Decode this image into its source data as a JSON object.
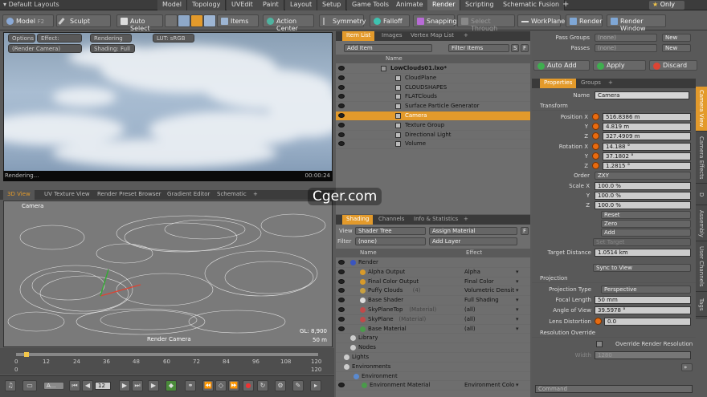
{
  "topbar": {
    "layout": "Default Layouts",
    "tabs": [
      "Model",
      "Topology",
      "UVEdit",
      "Paint",
      "Layout",
      "Setup",
      "Game Tools",
      "Animate",
      "Render",
      "Scripting",
      "Schematic Fusion"
    ],
    "active_tab": "Render",
    "only": "Only"
  },
  "toolbar": {
    "model": "Model",
    "model_key": "F2",
    "sculpt": "Sculpt",
    "auto_select": "Auto Select",
    "items": "Items",
    "action_center": "Action Center",
    "symmetry": "Symmetry",
    "falloff": "Falloff",
    "snapping": "Snapping",
    "select_through": "Select Through",
    "workplane": "WorkPlane",
    "render": "Render",
    "render_window": "Render Window"
  },
  "render_view": {
    "options": "Options",
    "effect": "Effect: Shadin",
    "rendering_dd": "Rendering",
    "lut": "LUT: sRGB",
    "camera": "(Render Camera)",
    "shading": "Shading: Full",
    "status": "Rendering...",
    "time": "00:00:24"
  },
  "view3d": {
    "tabs": [
      "3D View",
      "UV Texture View",
      "Render Preset Browser",
      "Gradient Editor",
      "Schematic"
    ],
    "camera": "Camera",
    "render_camera": "Render Camera",
    "gl": "GL: 8,900",
    "dist": "50 m"
  },
  "timeline": {
    "ticks": [
      "0",
      "12",
      "24",
      "36",
      "48",
      "60",
      "72",
      "84",
      "96",
      "108",
      "120"
    ],
    "start": "0",
    "end": "120"
  },
  "bottombar": {
    "anim": "A...",
    "frame": "12"
  },
  "item_list": {
    "tabs": [
      "Item List",
      "Images",
      "Vertex Map List"
    ],
    "add_item": "Add Item",
    "filter": "Filter Items",
    "s": "S",
    "f": "F",
    "name_col": "Name",
    "items": [
      {
        "name": "LowClouds01.lxo*",
        "indent": 0,
        "bold": true
      },
      {
        "name": "CloudPlane",
        "indent": 1
      },
      {
        "name": "CLOUDSHAPES",
        "indent": 1
      },
      {
        "name": "FLATClouds",
        "indent": 1
      },
      {
        "name": "Surface Particle Generator",
        "indent": 1
      },
      {
        "name": "Camera",
        "indent": 1,
        "selected": true
      },
      {
        "name": "Texture Group",
        "indent": 1
      },
      {
        "name": "Directional Light",
        "indent": 1
      },
      {
        "name": "Volume",
        "indent": 1
      }
    ]
  },
  "shading": {
    "tabs": [
      "Shading",
      "Channels",
      "Info & Statistics"
    ],
    "view_label": "View",
    "view": "Shader Tree",
    "assign": "Assign Material",
    "f": "F",
    "filter_label": "Filter",
    "filter": "(none)",
    "add_layer": "Add Layer",
    "cols": [
      "Name",
      "Effect"
    ],
    "rows": [
      {
        "name": "Render",
        "effect": ""
      },
      {
        "name": "Alpha Output",
        "effect": "Alpha"
      },
      {
        "name": "Final Color Output",
        "effect": "Final Color"
      },
      {
        "name": "Puffy Clouds",
        "tag": "(4)",
        "effect": "Volumetric Densit..."
      },
      {
        "name": "Base Shader",
        "effect": "Full Shading"
      },
      {
        "name": "SkyPlaneTop",
        "tag": "(Material)",
        "effect": "(all)"
      },
      {
        "name": "SkyPlane",
        "tag": "(Material)",
        "effect": "(all)"
      },
      {
        "name": "Base Material",
        "effect": "(all)"
      },
      {
        "name": "Library",
        "effect": ""
      },
      {
        "name": "Nodes",
        "effect": ""
      },
      {
        "name": "Lights",
        "effect": ""
      },
      {
        "name": "Environments",
        "effect": ""
      },
      {
        "name": "Environment",
        "effect": ""
      },
      {
        "name": "Environment Material",
        "effect": "Environment Color"
      }
    ]
  },
  "pass": {
    "groups_label": "Pass Groups",
    "groups": "(none)",
    "passes_label": "Passes",
    "passes": "(none)",
    "new": "New",
    "new2": "New",
    "auto_add": "Auto Add",
    "apply": "Apply",
    "discard": "Discard"
  },
  "properties": {
    "tabs": [
      "Properties",
      "Groups"
    ],
    "name_label": "Name",
    "name": "Camera",
    "transform": "Transform",
    "pos_label": "Position X",
    "pos": [
      "516.8386 m",
      "4.819 m",
      "327.4909 m"
    ],
    "rot_label": "Rotation X",
    "rot": [
      "14.188 °",
      "37.1802 °",
      "1.2815 °"
    ],
    "y": "Y",
    "z": "Z",
    "order_label": "Order",
    "order": "ZXY",
    "scale_label": "Scale X",
    "scale": [
      "100.0 %",
      "100.0 %",
      "100.0 %"
    ],
    "reset": "Reset",
    "zero": "Zero",
    "add": "Add",
    "set_target": "Set Target",
    "td_label": "Target Distance",
    "td": "1.0514 km",
    "sync": "Sync to View",
    "projection": "Projection",
    "proj_type_label": "Projection Type",
    "proj_type": "Perspective",
    "focal_label": "Focal Length",
    "focal": "50 mm",
    "aov_label": "Angle of View",
    "aov": "39.5978 °",
    "lens_label": "Lens Distortion",
    "lens": "0.0",
    "ro": "Resolution Override",
    "ro_check": "Override Render Resolution",
    "width_label": "Width",
    "width": "1280",
    "command": "Command"
  },
  "side_tabs": [
    "Camera View",
    "Camera Effects",
    "D",
    "Assembly",
    "User Channels",
    "Tags"
  ],
  "watermark": "Cger.com",
  "colors": {
    "accent": "#e39a2b",
    "orange": "#e86b10"
  }
}
